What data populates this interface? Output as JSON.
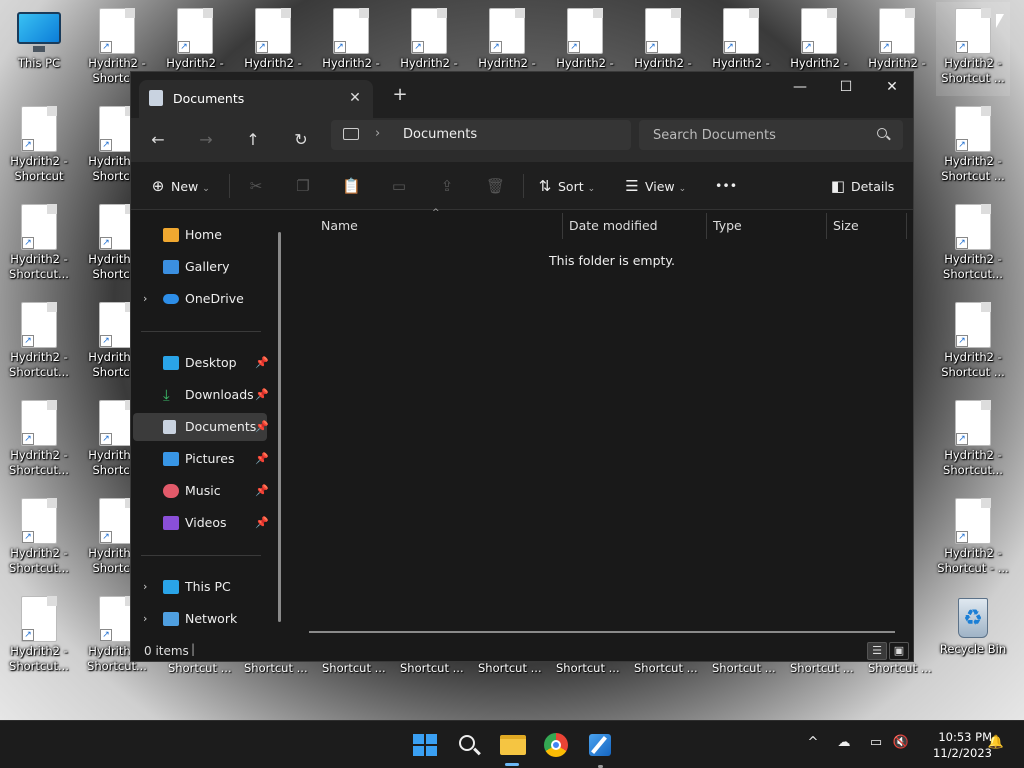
{
  "desktop": {
    "this_pc_label": "This PC",
    "recycle_bin_label": "Recycle Bin",
    "shortcut_label_1": "Hydrith2 - Shortcut",
    "shortcut_label_2": "Hydrith2 - Shortcut...",
    "shortcut_label_3": "Hydrith2 - Shortcut - ...",
    "shortcut_label_4": "Hydrith2 - Shortcut ...",
    "top_row_label": "Hydrith2 -",
    "bottom_row_label": "Shortcut ..."
  },
  "window": {
    "tab_title": "Documents",
    "tab_close": "✕",
    "new_tab": "+",
    "minimize": "—",
    "maximize": "☐",
    "close": "✕"
  },
  "navbar": {
    "back": "←",
    "forward": "→",
    "up": "↑",
    "refresh": "↻",
    "breadcrumb_sep": "›",
    "breadcrumb": "Documents",
    "search_placeholder": "Search Documents"
  },
  "toolbar": {
    "new_label": "New",
    "sort_label": "Sort",
    "view_label": "View",
    "more": "•••",
    "details_label": "Details",
    "icons": [
      "cut-icon",
      "copy-icon",
      "paste-icon",
      "rename-icon",
      "share-icon",
      "delete-icon"
    ]
  },
  "nav_pane": {
    "home": "Home",
    "gallery": "Gallery",
    "onedrive": "OneDrive",
    "desktop": "Desktop",
    "downloads": "Downloads",
    "documents": "Documents",
    "pictures": "Pictures",
    "music": "Music",
    "videos": "Videos",
    "this_pc": "This PC",
    "network": "Network",
    "expand_glyph": "›",
    "pin_glyph": "📌"
  },
  "content": {
    "columns": [
      "Name",
      "Date modified",
      "Type",
      "Size"
    ],
    "empty_message": "This folder is empty."
  },
  "status": {
    "item_count": "0 items"
  },
  "tray": {
    "time": "10:53 PM",
    "date": "11/2/2023",
    "chevron": "^"
  },
  "colors": {
    "accent": "#3aa0f3",
    "window_bg": "#191919",
    "toolbar_bg": "#1f1f1f",
    "taskbar_bg": "#1c1c1c"
  }
}
